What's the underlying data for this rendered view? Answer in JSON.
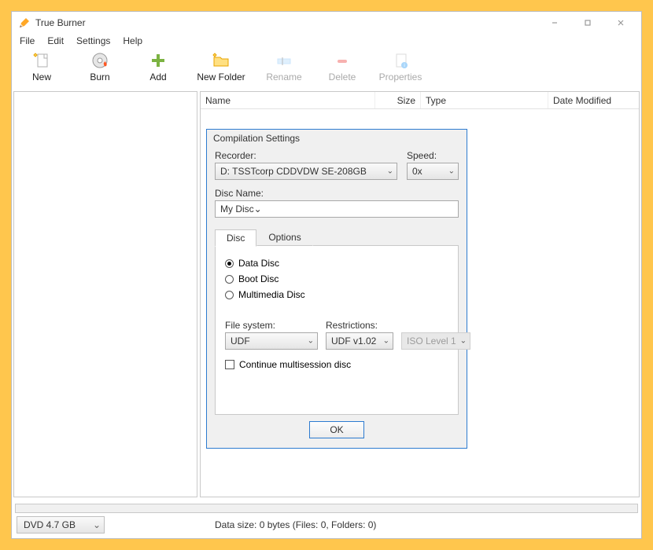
{
  "app": {
    "title": "True Burner"
  },
  "menu": {
    "file": "File",
    "edit": "Edit",
    "settings": "Settings",
    "help": "Help"
  },
  "toolbar": {
    "new": "New",
    "burn": "Burn",
    "add": "Add",
    "newfolder": "New Folder",
    "rename": "Rename",
    "delete": "Delete",
    "properties": "Properties"
  },
  "columns": {
    "name": "Name",
    "size": "Size",
    "type": "Type",
    "date": "Date Modified"
  },
  "status": {
    "disc_type": "DVD 4.7 GB",
    "text": "Data size: 0 bytes (Files: 0, Folders: 0)"
  },
  "dialog": {
    "title": "Compilation Settings",
    "recorder_label": "Recorder:",
    "recorder_value": "D: TSSTcorp CDDVDW SE-208GB",
    "speed_label": "Speed:",
    "speed_value": "0x",
    "discname_label": "Disc Name:",
    "discname_value": "My Disc",
    "tabs": {
      "disc": "Disc",
      "options": "Options"
    },
    "radios": {
      "data": "Data Disc",
      "boot": "Boot Disc",
      "multimedia": "Multimedia Disc"
    },
    "filesystem_label": "File system:",
    "filesystem_value": "UDF",
    "restrictions_label": "Restrictions:",
    "restrictions_value": "UDF v1.02",
    "iso_value": "ISO Level 1",
    "continue_label": "Continue multisession disc",
    "ok": "OK"
  }
}
